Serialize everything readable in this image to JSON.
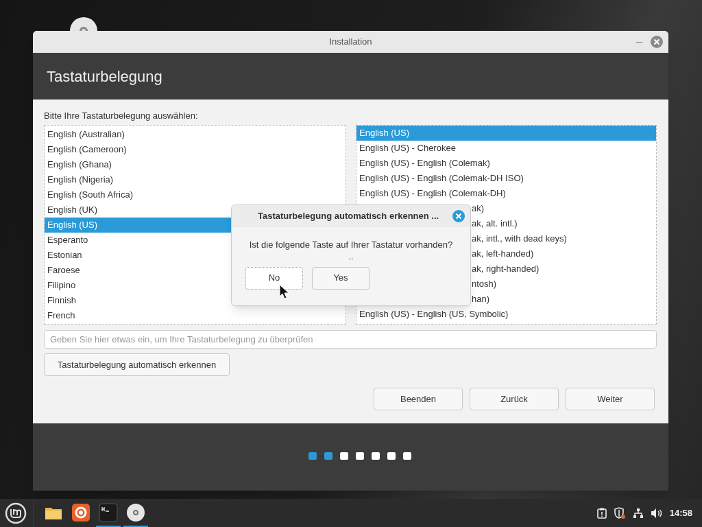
{
  "window": {
    "title": "Installation"
  },
  "header": {
    "title": "Tastaturbelegung"
  },
  "prompt": "Bitte Ihre Tastaturbelegung auswählen:",
  "layouts": [
    {
      "label": "English (Australian)",
      "selected": false
    },
    {
      "label": "English (Cameroon)",
      "selected": false
    },
    {
      "label": "English (Ghana)",
      "selected": false
    },
    {
      "label": "English (Nigeria)",
      "selected": false
    },
    {
      "label": "English (South Africa)",
      "selected": false
    },
    {
      "label": "English (UK)",
      "selected": false
    },
    {
      "label": "English (US)",
      "selected": true
    },
    {
      "label": "Esperanto",
      "selected": false
    },
    {
      "label": "Estonian",
      "selected": false
    },
    {
      "label": "Faroese",
      "selected": false
    },
    {
      "label": "Filipino",
      "selected": false
    },
    {
      "label": "Finnish",
      "selected": false
    },
    {
      "label": "French",
      "selected": false
    }
  ],
  "variants": [
    {
      "label": "English (US)",
      "selected": true,
      "covered": false
    },
    {
      "label": "English (US) - Cherokee",
      "selected": false,
      "covered": false
    },
    {
      "label": "English (US) - English (Colemak)",
      "selected": false,
      "covered": false
    },
    {
      "label": "English (US) - English (Colemak-DH ISO)",
      "selected": false,
      "covered": false
    },
    {
      "label": "English (US) - English (Colemak-DH)",
      "selected": false,
      "covered": false
    },
    {
      "label": "ak)",
      "selected": false,
      "covered": true
    },
    {
      "label": "ak, alt. intl.)",
      "selected": false,
      "covered": true
    },
    {
      "label": "ak, intl., with dead keys)",
      "selected": false,
      "covered": true
    },
    {
      "label": "ak, left-handed)",
      "selected": false,
      "covered": true
    },
    {
      "label": "ak, right-handed)",
      "selected": false,
      "covered": true
    },
    {
      "label": "ntosh)",
      "selected": false,
      "covered": true
    },
    {
      "label": "han)",
      "selected": false,
      "covered": true
    },
    {
      "label": "English (US) - English (US, Symbolic)",
      "selected": false,
      "covered": false
    }
  ],
  "test_field": {
    "placeholder": "Geben Sie hier etwas ein, um Ihre Tastaturbelegung zu überprüfen"
  },
  "detect_button": "Tastaturbelegung automatisch erkennen",
  "nav_buttons": [
    "Beenden",
    "Zurück",
    "Weiter"
  ],
  "steps": [
    {
      "done": true
    },
    {
      "done": true
    },
    {
      "done": false
    },
    {
      "done": false
    },
    {
      "done": false
    },
    {
      "done": false
    },
    {
      "done": false
    }
  ],
  "dialog": {
    "title": "Tastaturbelegung automatisch erkennen ...",
    "question": "Ist die folgende Taste auf Ihrer Tastatur vorhanden?",
    "key": "..",
    "buttons": [
      {
        "label": "No",
        "focused": true
      },
      {
        "label": "Yes",
        "focused": false
      }
    ]
  },
  "taskbar": {
    "apps": [
      {
        "kind": "folder",
        "running": false
      },
      {
        "kind": "browser",
        "running": false
      },
      {
        "kind": "terminal",
        "running": true
      },
      {
        "kind": "disc",
        "running": true
      }
    ],
    "clock": "14:58"
  }
}
